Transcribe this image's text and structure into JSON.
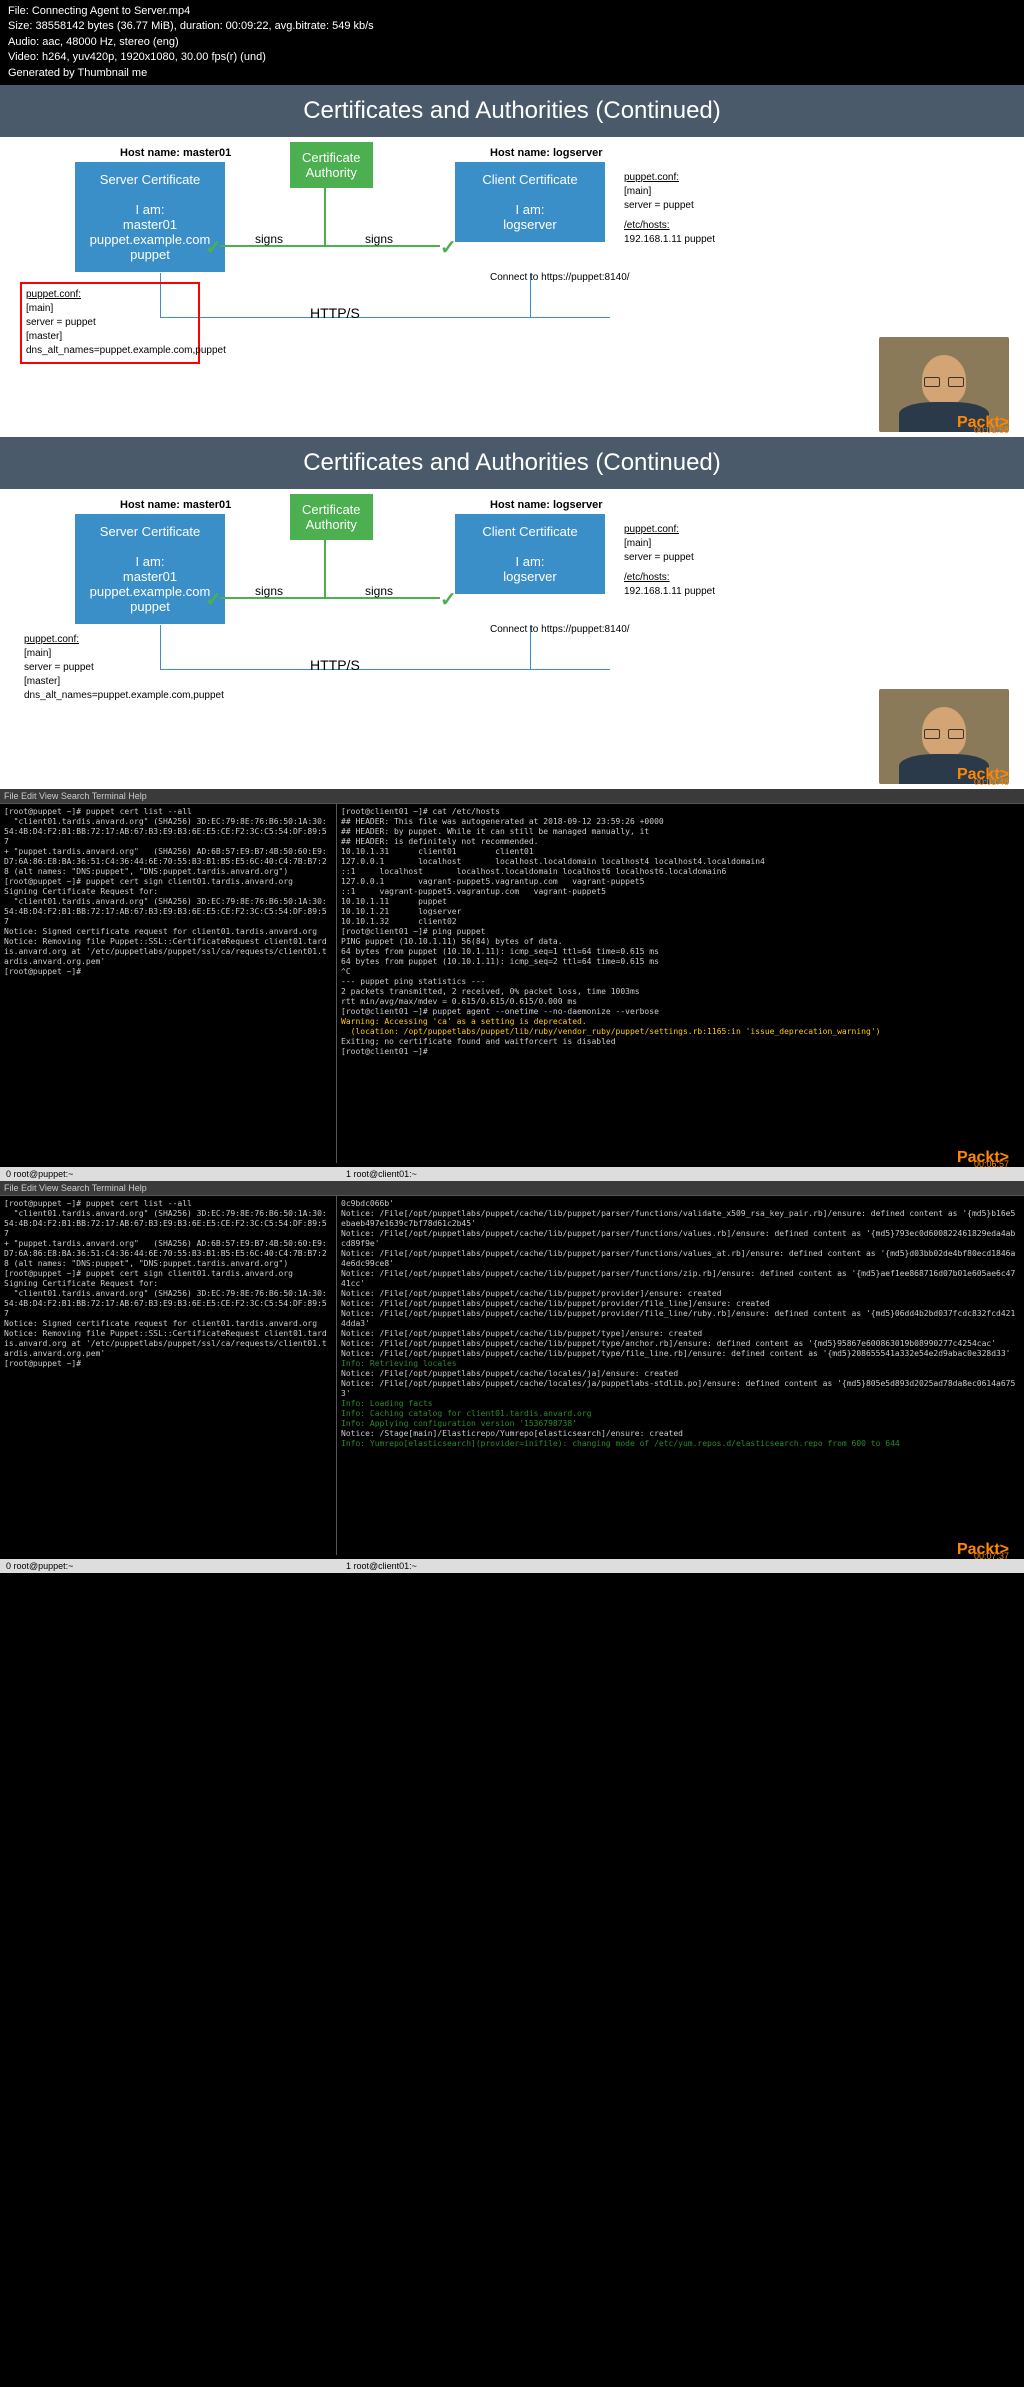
{
  "info": {
    "line1": "File: Connecting Agent to Server.mp4",
    "line2": "Size: 38558142 bytes (36.77 MiB), duration: 00:09:22, avg.bitrate: 549 kb/s",
    "line3": "Audio: aac, 48000 Hz, stereo (eng)",
    "line4": "Video: h264, yuv420p, 1920x1080, 30.00 fps(r) (und)",
    "line5": "Generated by Thumbnail me"
  },
  "slide": {
    "title": "Certificates and Authorities (Continued)",
    "host1": "Host name: master01",
    "host2": "Host name: logserver",
    "serverCert": {
      "title": "Server Certificate",
      "iam": "I am:",
      "l1": "master01",
      "l2": "puppet.example.com",
      "l3": "puppet"
    },
    "clientCert": {
      "title": "Client Certificate",
      "iam": "I am:",
      "l1": "logserver"
    },
    "ca": {
      "l1": "Certificate",
      "l2": "Authority"
    },
    "signs": "signs",
    "https": "HTTP/S",
    "connect": "Connect to https://puppet:8140/",
    "confLeft": {
      "l1": "puppet.conf:",
      "l2": "[main]",
      "l3": "server = puppet",
      "l4": "[master]",
      "l5": "dns_alt_names=puppet.example.com,puppet"
    },
    "confRight1": {
      "l1": "puppet.conf:",
      "l2": "[main]",
      "l3": "server = puppet"
    },
    "confRight2": {
      "l1": "/etc/hosts:",
      "l2": "192.168.1.11 puppet"
    },
    "watermark": "Packt>",
    "ts1": "00:01:58",
    "ts2": "00:03:48",
    "ts3": "00:06:57",
    "ts4": "00:07:37"
  },
  "term": {
    "menu": "File Edit View Search Terminal Help",
    "status_l": "0 root@puppet:~",
    "status_r": "1 root@client01:~",
    "left1": "[root@puppet ~]# puppet cert list --all\n  \"client01.tardis.anvard.org\" (SHA256) 3D:EC:79:8E:76:B6:50:1A:30:54:4B:D4:F2:B1:BB:72:17:AB:67:B3:E9:B3:6E:E5:CE:F2:3C:C5:54:DF:89:57\n+ \"puppet.tardis.anvard.org\"   (SHA256) AD:6B:57:E9:B7:4B:50:60:E9:D7:6A:86:E8:BA:36:51:C4:36:44:6E:70:55:B3:B1:B5:E5:6C:40:C4:7B:B7:28 (alt names: \"DNS:puppet\", \"DNS:puppet.tardis.anvard.org\")\n[root@puppet ~]# puppet cert sign client01.tardis.anvard.org\nSigning Certificate Request for:\n  \"client01.tardis.anvard.org\" (SHA256) 3D:EC:79:8E:76:B6:50:1A:30:54:4B:D4:F2:B1:BB:72:17:AB:67:B3:E9:B3:6E:E5:CE:F2:3C:C5:54:DF:89:57\nNotice: Signed certificate request for client01.tardis.anvard.org\nNotice: Removing file Puppet::SSL::CertificateRequest client01.tardis.anvard.org at '/etc/puppetlabs/puppet/ssl/ca/requests/client01.tardis.anvard.org.pem'\n[root@puppet ~]#",
    "right1_a": "[root@client01 ~]# cat /etc/hosts\n## HEADER: This file was autogenerated at 2018-09-12 23:59:26 +0000\n## HEADER: by puppet. While it can still be managed manually, it\n## HEADER: is definitely not recommended.\n10.10.1.31      client01        client01\n127.0.0.1       localhost       localhost.localdomain localhost4 localhost4.localdomain4\n::1     localhost       localhost.localdomain localhost6 localhost6.localdomain6\n127.0.0.1       vagrant-puppet5.vagrantup.com   vagrant-puppet5\n::1     vagrant-puppet5.vagrantup.com   vagrant-puppet5\n10.10.1.11      puppet\n10.10.1.21      logserver\n10.10.1.32      client02\n[root@client01 ~]# ping puppet\nPING puppet (10.10.1.11) 56(84) bytes of data.\n64 bytes from puppet (10.10.1.11): icmp_seq=1 ttl=64 time=0.615 ms\n64 bytes from puppet (10.10.1.11): icmp_seq=2 ttl=64 time=0.615 ms\n^C\n--- puppet ping statistics ---\n2 packets transmitted, 2 received, 0% packet loss, time 1003ms\nrtt min/avg/max/mdev = 0.615/0.615/0.615/0.000 ms\n[root@client01 ~]# puppet agent --onetime --no-daemonize --verbose",
    "right1_warn1": "Warning: Accessing 'ca' as a setting is deprecated.",
    "right1_warn2": "  (location: /opt/puppetlabs/puppet/lib/ruby/vendor_ruby/puppet/settings.rb:1165:in 'issue_deprecation_warning')",
    "right1_b": "Exiting; no certificate found and waitforcert is disabled\n[root@client01 ~]#",
    "left2": "[root@puppet ~]# puppet cert list --all\n  \"client01.tardis.anvard.org\" (SHA256) 3D:EC:79:8E:76:B6:50:1A:30:54:4B:D4:F2:B1:BB:72:17:AB:67:B3:E9:B3:6E:E5:CE:F2:3C:C5:54:DF:89:57\n+ \"puppet.tardis.anvard.org\"   (SHA256) AD:6B:57:E9:B7:4B:50:60:E9:D7:6A:86:E8:BA:36:51:C4:36:44:6E:70:55:B3:B1:B5:E5:6C:40:C4:7B:B7:28 (alt names: \"DNS:puppet\", \"DNS:puppet.tardis.anvard.org\")\n[root@puppet ~]# puppet cert sign client01.tardis.anvard.org\nSigning Certificate Request for:\n  \"client01.tardis.anvard.org\" (SHA256) 3D:EC:79:8E:76:B6:50:1A:30:54:4B:D4:F2:B1:BB:72:17:AB:67:B3:E9:B3:6E:E5:CE:F2:3C:C5:54:DF:89:57\nNotice: Signed certificate request for client01.tardis.anvard.org\nNotice: Removing file Puppet::SSL::CertificateRequest client01.tardis.anvard.org at '/etc/puppetlabs/puppet/ssl/ca/requests/client01.tardis.anvard.org.pem'\n[root@puppet ~]#",
    "right2_a": "0c9bdc066b'\nNotice: /File[/opt/puppetlabs/puppet/cache/lib/puppet/parser/functions/validate_x509_rsa_key_pair.rb]/ensure: defined content as '{md5}b16e5ebaeb497e1639c7bf78d61c2b45'\nNotice: /File[/opt/puppetlabs/puppet/cache/lib/puppet/parser/functions/values.rb]/ensure: defined content as '{md5}793ec0d600822461829eda4abcd89f9e'\nNotice: /File[/opt/puppetlabs/puppet/cache/lib/puppet/parser/functions/values_at.rb]/ensure: defined content as '{md5}d03bb02de4bf80ecd1846a4e6dc99ce8'\nNotice: /File[/opt/puppetlabs/puppet/cache/lib/puppet/parser/functions/zip.rb]/ensure: defined content as '{md5}aef1ee868716d07b01e605ae6c4741cc'\nNotice: /File[/opt/puppetlabs/puppet/cache/lib/puppet/provider]/ensure: created\nNotice: /File[/opt/puppetlabs/puppet/cache/lib/puppet/provider/file_line]/ensure: created\nNotice: /File[/opt/puppetlabs/puppet/cache/lib/puppet/provider/file_line/ruby.rb]/ensure: defined content as '{md5}06dd4b2bd037fcdc832fcd4214dda3'\nNotice: /File[/opt/puppetlabs/puppet/cache/lib/puppet/type]/ensure: created\nNotice: /File[/opt/puppetlabs/puppet/cache/lib/puppet/type/anchor.rb]/ensure: defined content as '{md5}95867e600863019b08990277c4254cac'\nNotice: /File[/opt/puppetlabs/puppet/cache/lib/puppet/type/file_line.rb]/ensure: defined content as '{md5}208655541a332e54e2d9abac0e328d33'",
    "right2_g1": "Info: Retrieving locales",
    "right2_b": "Notice: /File[/opt/puppetlabs/puppet/cache/locales/ja]/ensure: created\nNotice: /File[/opt/puppetlabs/puppet/cache/locales/ja/puppetlabs-stdlib.po]/ensure: defined content as '{md5}805e5d893d2025ad78da8ec0614a6753'",
    "right2_g2": "Info: Loading facts\nInfo: Caching catalog for client01.tardis.anvard.org\nInfo: Applying configuration version '1536798738'",
    "right2_c": "Notice: /Stage[main]/Elasticrepo/Yumrepo[elasticsearch]/ensure: created",
    "right2_g3": "Info: Yumrepo[elasticsearch](provider=inifile): changing mode of /etc/yum.repos.d/elasticsearch.repo from 600 to 644"
  }
}
